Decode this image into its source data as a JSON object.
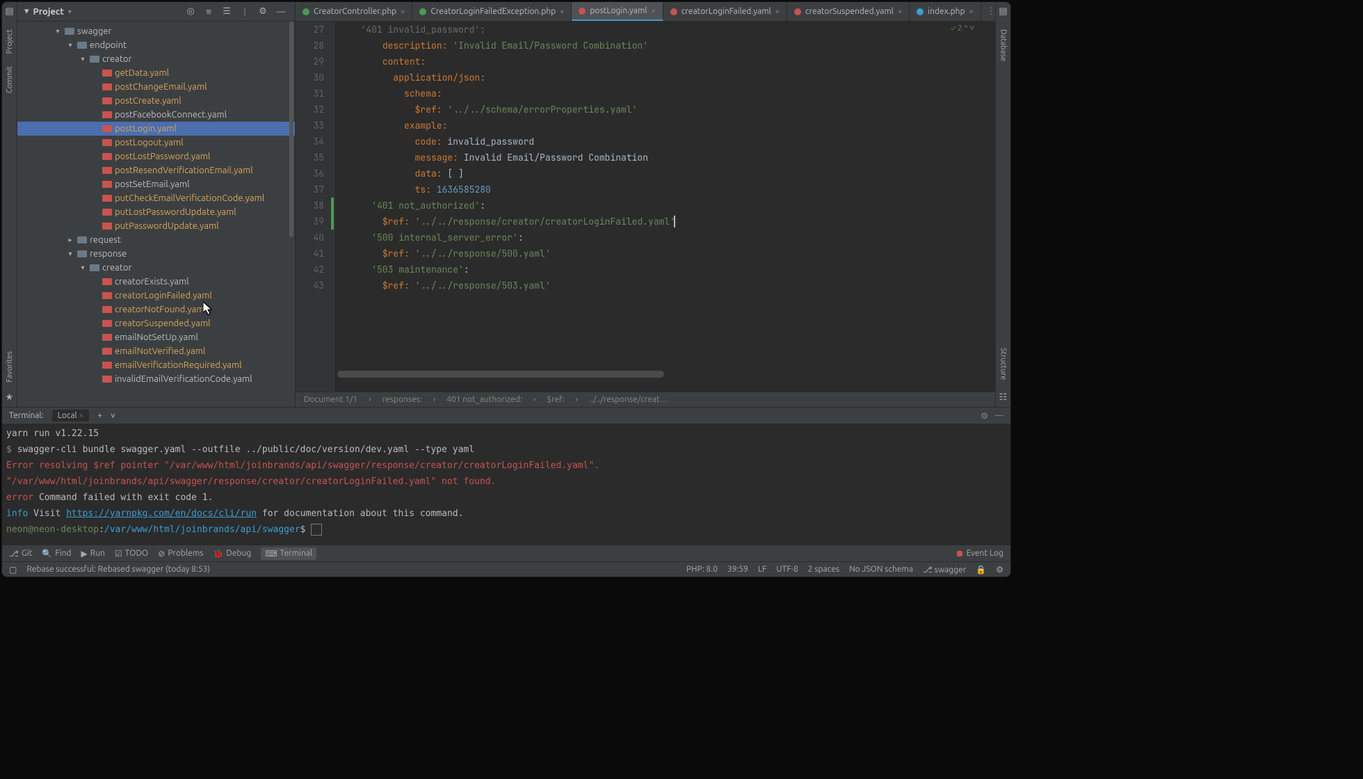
{
  "project": {
    "title": "Project",
    "toolbar_icons": [
      "target-icon",
      "expand-icon",
      "collapse-icon",
      "gear-icon",
      "minimize-icon"
    ]
  },
  "tree": [
    {
      "depth": 0,
      "chev": "▾",
      "type": "folder",
      "label": "swagger",
      "hl": false
    },
    {
      "depth": 1,
      "chev": "▾",
      "type": "folder",
      "label": "endpoint",
      "hl": false
    },
    {
      "depth": 2,
      "chev": "▾",
      "type": "folder",
      "label": "creator",
      "hl": false
    },
    {
      "depth": 3,
      "chev": "",
      "type": "yaml",
      "label": "getData.yaml",
      "hl": true
    },
    {
      "depth": 3,
      "chev": "",
      "type": "yaml",
      "label": "postChangeEmail.yaml",
      "hl": true
    },
    {
      "depth": 3,
      "chev": "",
      "type": "yaml",
      "label": "postCreate.yaml",
      "hl": true
    },
    {
      "depth": 3,
      "chev": "",
      "type": "yaml",
      "label": "postFacebookConnect.yaml",
      "hl": false
    },
    {
      "depth": 3,
      "chev": "",
      "type": "yaml",
      "label": "postLogin.yaml",
      "hl": true,
      "sel": true
    },
    {
      "depth": 3,
      "chev": "",
      "type": "yaml",
      "label": "postLogout.yaml",
      "hl": true
    },
    {
      "depth": 3,
      "chev": "",
      "type": "yaml",
      "label": "postLostPassword.yaml",
      "hl": true
    },
    {
      "depth": 3,
      "chev": "",
      "type": "yaml",
      "label": "postResendVerificationEmail.yaml",
      "hl": true
    },
    {
      "depth": 3,
      "chev": "",
      "type": "yaml",
      "label": "postSetEmail.yaml",
      "hl": false
    },
    {
      "depth": 3,
      "chev": "",
      "type": "yaml",
      "label": "putCheckEmailVerificationCode.yaml",
      "hl": true
    },
    {
      "depth": 3,
      "chev": "",
      "type": "yaml",
      "label": "putLostPasswordUpdate.yaml",
      "hl": true
    },
    {
      "depth": 3,
      "chev": "",
      "type": "yaml",
      "label": "putPasswordUpdate.yaml",
      "hl": true
    },
    {
      "depth": 1,
      "chev": "▸",
      "type": "folder",
      "label": "request",
      "hl": false
    },
    {
      "depth": 1,
      "chev": "▾",
      "type": "folder",
      "label": "response",
      "hl": false
    },
    {
      "depth": 2,
      "chev": "▾",
      "type": "folder",
      "label": "creator",
      "hl": false
    },
    {
      "depth": 3,
      "chev": "",
      "type": "yaml",
      "label": "creatorExists.yaml",
      "hl": false
    },
    {
      "depth": 3,
      "chev": "",
      "type": "yaml",
      "label": "creatorLoginFailed.yaml",
      "hl": true
    },
    {
      "depth": 3,
      "chev": "",
      "type": "yaml",
      "label": "creatorNotFound.yaml",
      "hl": true
    },
    {
      "depth": 3,
      "chev": "",
      "type": "yaml",
      "label": "creatorSuspended.yaml",
      "hl": true
    },
    {
      "depth": 3,
      "chev": "",
      "type": "yaml",
      "label": "emailNotSetUp.yaml",
      "hl": false
    },
    {
      "depth": 3,
      "chev": "",
      "type": "yaml",
      "label": "emailNotVerified.yaml",
      "hl": true
    },
    {
      "depth": 3,
      "chev": "",
      "type": "yaml",
      "label": "emailVerificationRequired.yaml",
      "hl": true
    },
    {
      "depth": 3,
      "chev": "",
      "type": "yaml",
      "label": "invalidEmailVerificationCode.yaml",
      "hl": false
    }
  ],
  "tabs": [
    {
      "label": "CreatorController.php",
      "color": "green"
    },
    {
      "label": "CreatorLoginFailedException.php",
      "color": "green"
    },
    {
      "label": "postLogin.yaml",
      "color": "red",
      "active": true
    },
    {
      "label": "creatorLoginFailed.yaml",
      "color": "red"
    },
    {
      "label": "creatorSuspended.yaml",
      "color": "red"
    },
    {
      "label": "index.php",
      "color": "blue"
    }
  ],
  "editor": {
    "check_badge": "✓ 2",
    "first_partial": "'401 invalid_password':",
    "lines": [
      {
        "n": 27,
        "partial": true
      },
      {
        "n": 28,
        "i": 3,
        "k": "description:",
        "s": "'Invalid Email/Password Combination'"
      },
      {
        "n": 29,
        "i": 3,
        "k": "content:"
      },
      {
        "n": 30,
        "i": 4,
        "k": "application/json:"
      },
      {
        "n": 31,
        "i": 5,
        "k": "schema:"
      },
      {
        "n": 32,
        "i": 6,
        "k": "$ref:",
        "s": "'../../schema/errorProperties.yaml'"
      },
      {
        "n": 33,
        "i": 5,
        "k": "example:"
      },
      {
        "n": 34,
        "i": 6,
        "k": "code:",
        "v": "invalid_password"
      },
      {
        "n": 35,
        "i": 6,
        "k": "message:",
        "v": "Invalid Email/Password Combination"
      },
      {
        "n": 36,
        "i": 6,
        "k": "data:",
        "v": "[ ]"
      },
      {
        "n": 37,
        "i": 6,
        "k": "ts:",
        "num": "1636585280"
      },
      {
        "n": 38,
        "i": 2,
        "lit": "'401 not_authorized':"
      },
      {
        "n": 39,
        "i": 3,
        "k": "$ref:",
        "s": "'../../response/creator/creatorLoginFailed.yaml'",
        "caret": true
      },
      {
        "n": 40,
        "i": 2,
        "lit": "'500 internal_server_error':"
      },
      {
        "n": 41,
        "i": 3,
        "k": "$ref:",
        "s": "'../../response/500.yaml'"
      },
      {
        "n": 42,
        "i": 2,
        "lit": "'503 maintenance':"
      },
      {
        "n": 43,
        "i": 3,
        "k": "$ref:",
        "s": "'../../response/503.yaml'"
      }
    ],
    "crumbs": [
      "Document 1/1",
      "responses:",
      "401 not_authorized:",
      "$ref:",
      "../../response/creat…"
    ]
  },
  "terminal": {
    "title": "Terminal:",
    "tab": "Local",
    "lines": [
      {
        "cls": "",
        "text": "yarn run v1.22.15"
      },
      {
        "cls": "",
        "prefix": "$ ",
        "text": "swagger-cli bundle swagger.yaml --outfile ../public/doc/version/dev.yaml --type yaml"
      },
      {
        "cls": "t-red",
        "text": "Error resolving $ref pointer \"/var/www/html/joinbrands/api/swagger/response/creator/creatorLoginFailed.yaml\"."
      },
      {
        "cls": "t-red",
        "text": "\"/var/www/html/joinbrands/api/swagger/response/creator/creatorLoginFailed.yaml\" not found."
      },
      {
        "cls": "",
        "pre": "error",
        "precls": "t-red",
        "text": " Command failed with exit code 1."
      },
      {
        "cls": "",
        "pre": "info",
        "precls": "t-blue",
        "text": " Visit ",
        "link": "https://yarnpkg.com/en/docs/cli/run",
        "tail": " for documentation about this command."
      },
      {
        "prompt": true,
        "user": "neon@neon-desktop",
        "sep": ":",
        "path": "/var/www/html/joinbrands/api/swagger",
        "end": "$"
      }
    ]
  },
  "bottom_tools": {
    "items": [
      {
        "icon": "⎇",
        "label": "Git"
      },
      {
        "icon": "🔍",
        "label": "Find"
      },
      {
        "icon": "▶",
        "label": "Run"
      },
      {
        "icon": "☑",
        "label": "TODO"
      },
      {
        "icon": "⊘",
        "label": "Problems"
      },
      {
        "icon": "🐞",
        "label": "Debug"
      },
      {
        "icon": "⌨",
        "label": "Terminal",
        "active": true
      }
    ],
    "event_log": "Event Log"
  },
  "status": {
    "msg": "Rebase successful: Rebased swagger (today 8:53)",
    "right": [
      "PHP: 8.0",
      "39:59",
      "LF",
      "UTF-8",
      "2 spaces",
      "No JSON schema",
      "⎇ swagger"
    ]
  },
  "sidebars": {
    "left": [
      "Project",
      "Commit"
    ],
    "left_bottom_icon": "★",
    "left_bottom_label": "Favorites",
    "right": [
      "Database"
    ],
    "right_bottom": "Structure"
  }
}
